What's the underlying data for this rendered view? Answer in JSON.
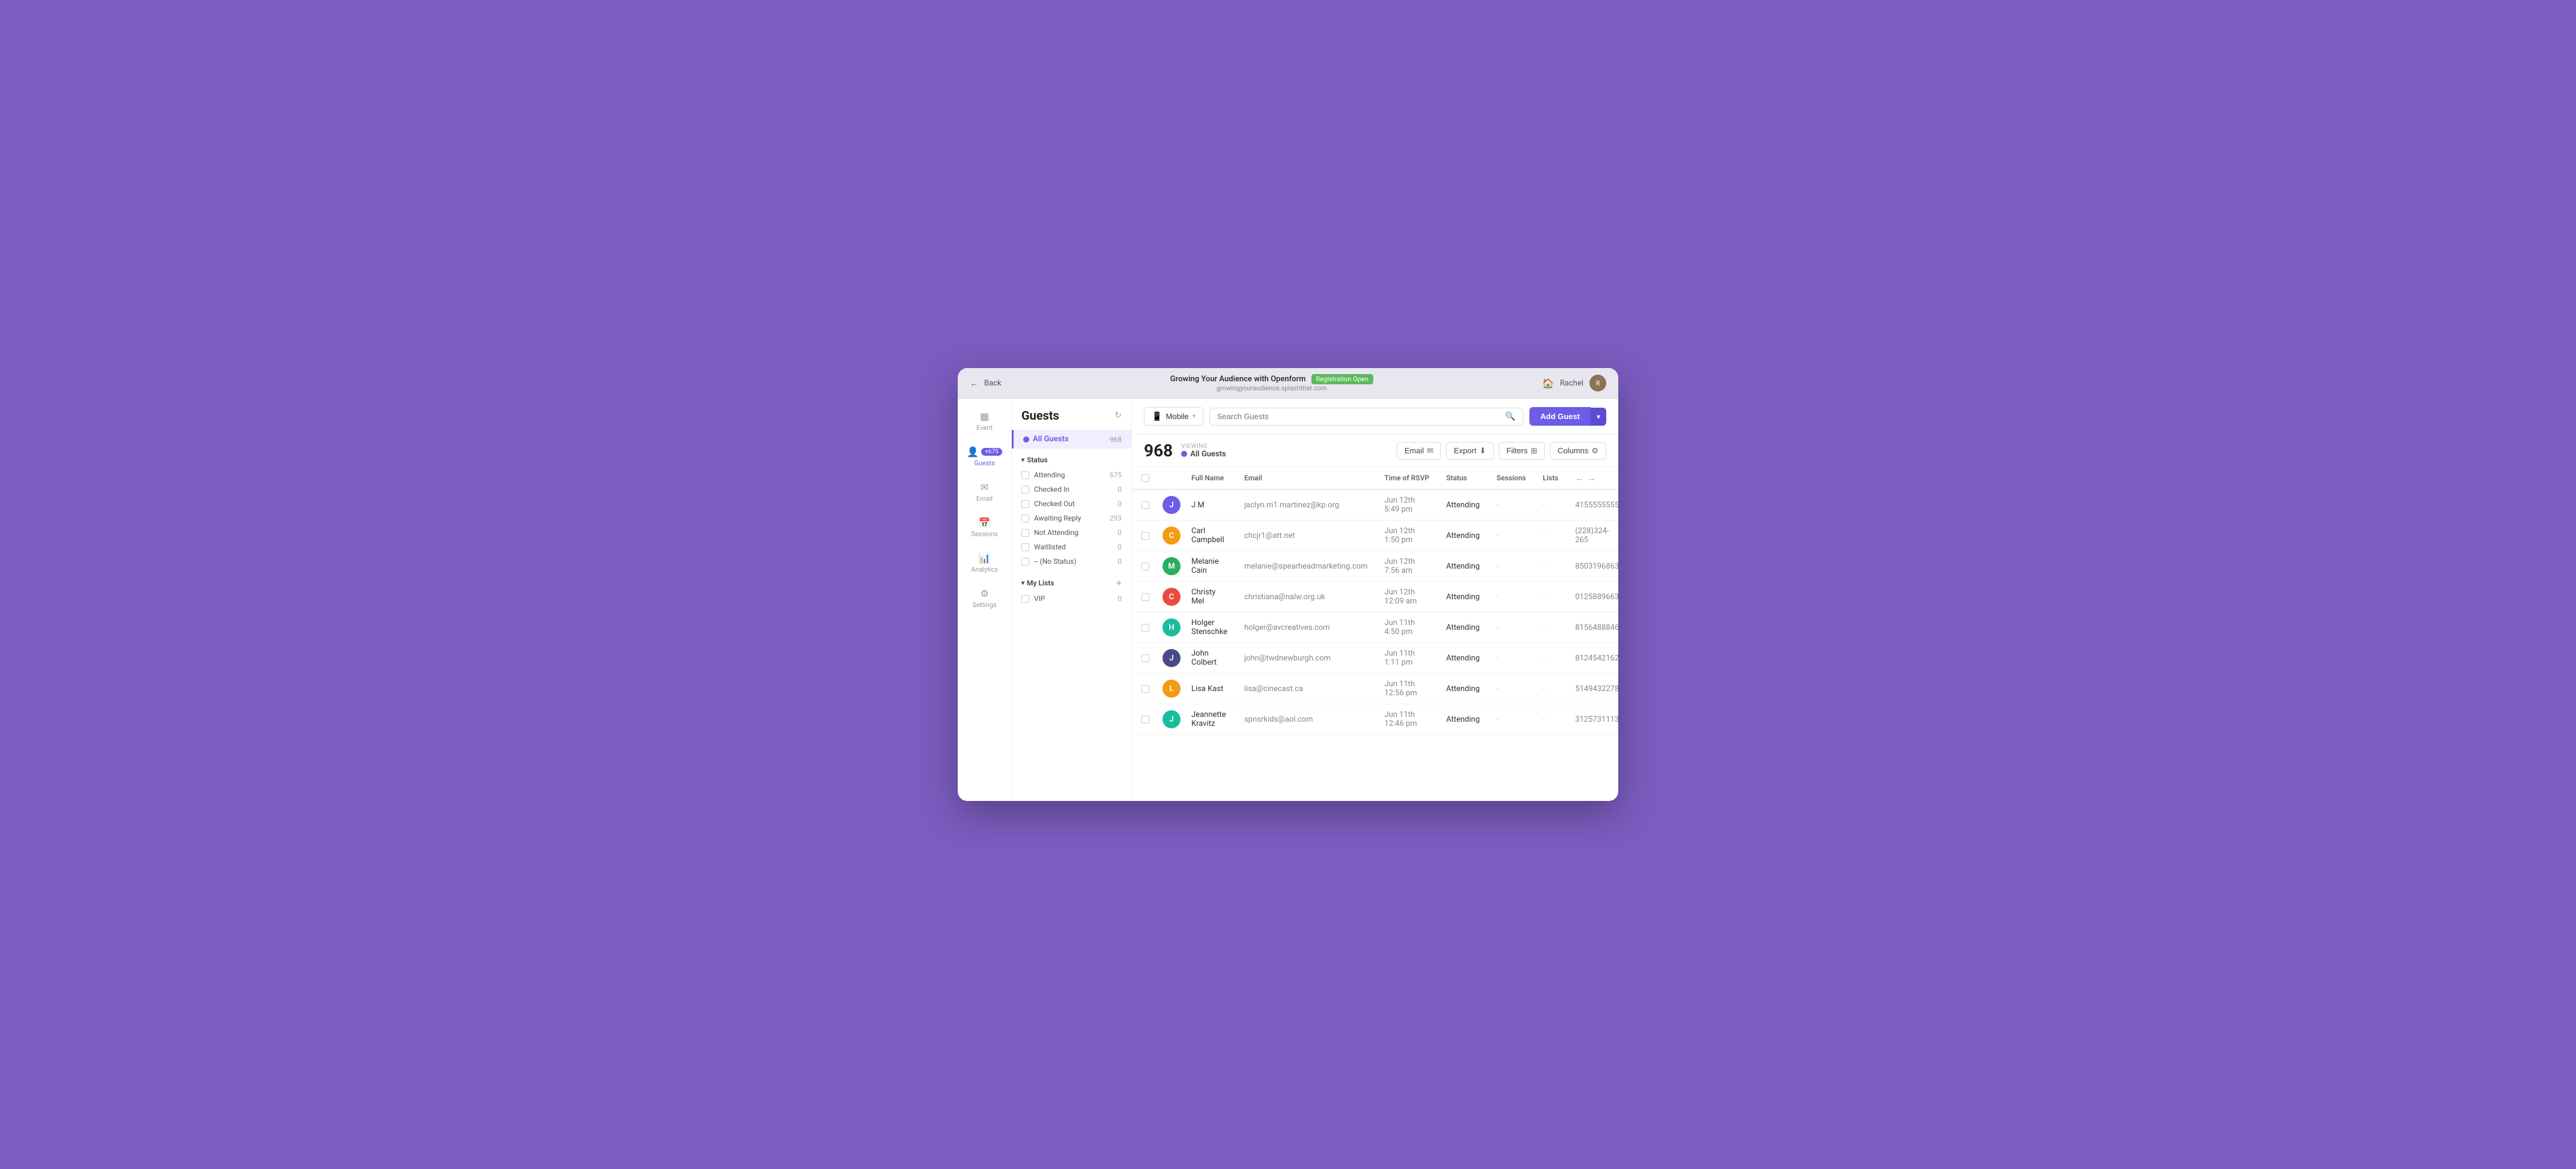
{
  "browser": {
    "back_label": "Back",
    "event_title": "Growing Your Audience with Openform",
    "event_status": "Registration Open",
    "event_url": "growingyouraudience.splashthat.com",
    "user_name": "Rachel",
    "home_icon": "🏠"
  },
  "nav": {
    "items": [
      {
        "id": "event",
        "icon": "▦",
        "label": "Event",
        "active": false
      },
      {
        "id": "guests",
        "icon": "👤",
        "label": "Guests",
        "badge": "+675",
        "active": true
      },
      {
        "id": "email",
        "icon": "✉",
        "label": "Email",
        "active": false
      },
      {
        "id": "sessions",
        "icon": "📅",
        "label": "Sessions",
        "active": false
      },
      {
        "id": "analytics",
        "icon": "📊",
        "label": "Analytics",
        "active": false
      },
      {
        "id": "settings",
        "icon": "⚙",
        "label": "Settings",
        "active": false
      }
    ]
  },
  "sidebar": {
    "title": "Guests",
    "all_guests_label": "All Guests",
    "all_guests_count": "968",
    "status_section": "Status",
    "filters": [
      {
        "label": "Attending",
        "count": "675"
      },
      {
        "label": "Checked In",
        "count": "0"
      },
      {
        "label": "Checked Out",
        "count": "0"
      },
      {
        "label": "Awaiting Reply",
        "count": "293"
      },
      {
        "label": "Not Attending",
        "count": "0"
      },
      {
        "label": "Waitlisted",
        "count": "0"
      },
      {
        "label": "-- (No Status)",
        "count": "0"
      }
    ],
    "my_lists_label": "My Lists",
    "lists": [
      {
        "label": "VIP",
        "count": "0"
      }
    ]
  },
  "toolbar": {
    "mobile_label": "Mobile",
    "search_placeholder": "Search Guests",
    "add_guest_label": "Add Guest"
  },
  "stats": {
    "count": "968",
    "viewing_label": "VIEWING",
    "viewing_value": "All Guests",
    "email_btn": "Email",
    "export_btn": "Export",
    "filters_btn": "Filters",
    "columns_btn": "Columns"
  },
  "table": {
    "columns": [
      {
        "id": "full_name",
        "label": "Full Name"
      },
      {
        "id": "email",
        "label": "Email"
      },
      {
        "id": "rsvp_time",
        "label": "Time of RSVP"
      },
      {
        "id": "status",
        "label": "Status"
      },
      {
        "id": "sessions",
        "label": "Sessions"
      },
      {
        "id": "lists",
        "label": "Lists"
      },
      {
        "id": "extra",
        "label": ""
      }
    ],
    "rows": [
      {
        "initials": "J",
        "color": "#6c5ce7",
        "full_name": "J M",
        "email": "jaclyn.m1.martinez@kp.org",
        "rsvp_time": "Jun 12th 5:49 pm",
        "status": "Attending",
        "sessions": "-",
        "lists": "-",
        "extra": "4155555555"
      },
      {
        "initials": "C",
        "color": "#f39c12",
        "full_name": "Carl Campbell",
        "email": "chcjr1@att.net",
        "rsvp_time": "Jun 12th 1:50 pm",
        "status": "Attending",
        "sessions": "-",
        "lists": "-",
        "extra": "(228)324-265"
      },
      {
        "initials": "M",
        "color": "#27ae60",
        "full_name": "Melanie Cain",
        "email": "melanie@spearheadmarketing.com",
        "rsvp_time": "Jun 12th 7:56 am",
        "status": "Attending",
        "sessions": "-",
        "lists": "-",
        "extra": "8503196863"
      },
      {
        "initials": "C",
        "color": "#e74c3c",
        "full_name": "Christy Mel",
        "email": "christiana@nalw.org.uk",
        "rsvp_time": "Jun 12th 12:09 am",
        "status": "Attending",
        "sessions": "-",
        "lists": "-",
        "extra": "0125889663"
      },
      {
        "initials": "H",
        "color": "#1abc9c",
        "full_name": "Holger Stenschke",
        "email": "holger@avcreatives.com",
        "rsvp_time": "Jun 11th 4:50 pm",
        "status": "Attending",
        "sessions": "-",
        "lists": "-",
        "extra": "8156488846"
      },
      {
        "initials": "J",
        "color": "#4a4a8a",
        "full_name": "John Colbert",
        "email": "john@twdnewburgh.com",
        "rsvp_time": "Jun 11th 1:11 pm",
        "status": "Attending",
        "sessions": "-",
        "lists": "-",
        "extra": "8124542162"
      },
      {
        "initials": "L",
        "color": "#f39c12",
        "full_name": "Lisa Kast",
        "email": "lisa@cinecast.ca",
        "rsvp_time": "Jun 11th 12:56 pm",
        "status": "Attending",
        "sessions": "-",
        "lists": "-",
        "extra": "5149432278"
      },
      {
        "initials": "J",
        "color": "#1abc9c",
        "full_name": "Jeannette Kravitz",
        "email": "spnsrkids@aol.com",
        "rsvp_time": "Jun 11th 12:46 pm",
        "status": "Attending",
        "sessions": "-",
        "lists": "-",
        "extra": "3125731113"
      }
    ]
  }
}
